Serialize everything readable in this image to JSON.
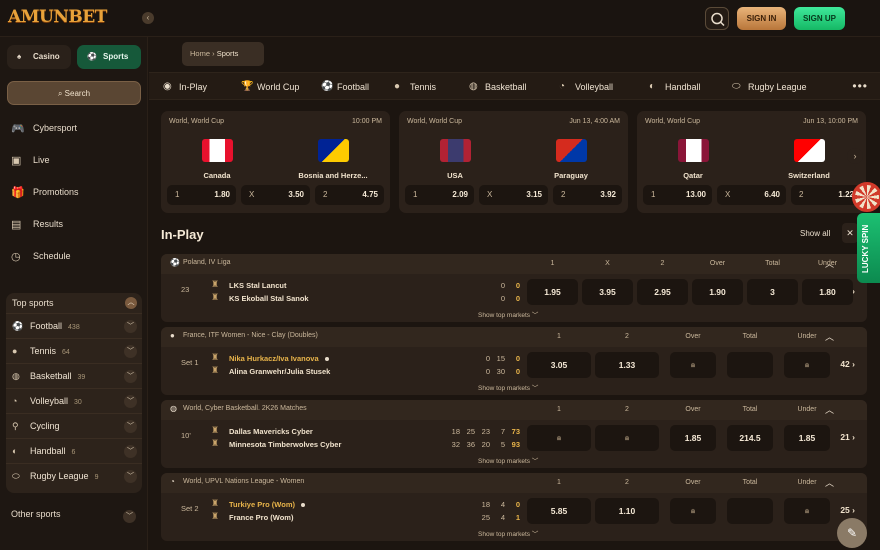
{
  "brand": {
    "logo_text": "AMUNBET"
  },
  "header": {
    "signin_label": "SIGN IN",
    "signup_label": "SIGN UP"
  },
  "sidebar": {
    "casino_label": "Casino",
    "sports_label": "Sports",
    "search_label": "Search",
    "nav": [
      {
        "label": "Cybersport",
        "icon": "gamepad-icon"
      },
      {
        "label": "Live",
        "icon": "live-tv-icon"
      },
      {
        "label": "Promotions",
        "icon": "gift-icon"
      },
      {
        "label": "Results",
        "icon": "clipboard-icon"
      },
      {
        "label": "Schedule",
        "icon": "clock-icon"
      }
    ],
    "top_sports_label": "Top sports",
    "top_sports": [
      {
        "label": "Football",
        "count": "438",
        "icon": "soccer-ball-icon"
      },
      {
        "label": "Tennis",
        "count": "64",
        "icon": "tennis-ball-icon"
      },
      {
        "label": "Basketball",
        "count": "39",
        "icon": "basketball-icon"
      },
      {
        "label": "Volleyball",
        "count": "30",
        "icon": "volleyball-icon"
      },
      {
        "label": "Cycling",
        "count": "",
        "icon": "bicycle-icon"
      },
      {
        "label": "Handball",
        "count": "6",
        "icon": "handball-icon"
      },
      {
        "label": "Rugby League",
        "count": "9",
        "icon": "rugby-ball-icon"
      }
    ],
    "other_sports_label": "Other sports"
  },
  "breadcrumb": {
    "home": "Home",
    "current": "Sports"
  },
  "tabs": [
    {
      "label": "In-Play",
      "icon": "live-icon"
    },
    {
      "label": "World Cup",
      "icon": "trophy-icon"
    },
    {
      "label": "Football",
      "icon": "soccer-ball-icon"
    },
    {
      "label": "Tennis",
      "icon": "tennis-ball-icon"
    },
    {
      "label": "Basketball",
      "icon": "basketball-icon"
    },
    {
      "label": "Volleyball",
      "icon": "volleyball-icon"
    },
    {
      "label": "Handball",
      "icon": "handball-icon"
    },
    {
      "label": "Rugby League",
      "icon": "rugby-ball-icon"
    }
  ],
  "featured": [
    {
      "league": "World, World Cup",
      "time": "10:00 PM",
      "home": "Canada",
      "away": "Bosnia and Herze...",
      "odds": [
        {
          "l": "1",
          "v": "1.80"
        },
        {
          "l": "X",
          "v": "3.50"
        },
        {
          "l": "2",
          "v": "4.75"
        }
      ],
      "home_colors": [
        "#e8112d",
        "#ffffff"
      ],
      "away_colors": [
        "#002395",
        "#fecb00"
      ]
    },
    {
      "league": "World, World Cup",
      "time": "Jun 13, 4:00 AM",
      "home": "USA",
      "away": "Paraguay",
      "odds": [
        {
          "l": "1",
          "v": "2.09"
        },
        {
          "l": "X",
          "v": "3.15"
        },
        {
          "l": "2",
          "v": "3.92"
        }
      ],
      "home_colors": [
        "#b22234",
        "#3c3b6e"
      ],
      "away_colors": [
        "#d52b1e",
        "#0038a8"
      ]
    },
    {
      "league": "World, World Cup",
      "time": "Jun 13, 10:00 PM",
      "home": "Qatar",
      "away": "Switzerland",
      "odds": [
        {
          "l": "1",
          "v": "13.00"
        },
        {
          "l": "X",
          "v": "6.40"
        },
        {
          "l": "2",
          "v": "1.22"
        }
      ],
      "home_colors": [
        "#8a1538",
        "#ffffff"
      ],
      "away_colors": [
        "#ff0000",
        "#ffffff"
      ]
    }
  ],
  "inplay": {
    "title": "In-Play",
    "show_all": "Show all",
    "show_top_markets": "Show top markets",
    "events": [
      {
        "league": "Poland, IV Liga",
        "period": "23",
        "home": "LKS Stal Lancut",
        "away": "KS Ekoball Stal Sanok",
        "serving": "",
        "scores": [
          [
            "0",
            "0"
          ],
          [
            "0",
            "0"
          ]
        ],
        "score_cols": 2,
        "cols": [
          "1",
          "X",
          "2",
          "Over",
          "Total",
          "Under"
        ],
        "odds": [
          "1.95",
          "3.95",
          "2.95",
          "1.90",
          "3",
          "1.80"
        ],
        "markets": "42"
      },
      {
        "league": "France, ITF Women - Nice - Clay (Doubles)",
        "period": "Set 1",
        "home": "Nika Hurkacz/Iva Ivanova",
        "away": "Alina Granwehr/Julia Stusek",
        "serving": "home",
        "scores": [
          [
            "0",
            "15",
            "0"
          ],
          [
            "0",
            "30",
            "0"
          ]
        ],
        "cols": [
          "1",
          "2",
          "Over",
          "Total",
          "Under"
        ],
        "odds": [
          "3.05",
          "1.33",
          "lock",
          "",
          "lock"
        ],
        "markets": "42"
      },
      {
        "league": "World, Cyber Basketball. 2K26 Matches",
        "period": "10'",
        "home": "Dallas Mavericks Cyber",
        "away": "Minnesota Timberwolves Cyber",
        "serving": "",
        "scores": [
          [
            "18",
            "25",
            "23",
            "7",
            "73"
          ],
          [
            "32",
            "36",
            "20",
            "5",
            "93"
          ]
        ],
        "cols": [
          "1",
          "2",
          "Over",
          "Total",
          "Under"
        ],
        "odds": [
          "lock",
          "lock",
          "1.85",
          "214.5",
          "1.85"
        ],
        "markets": "21"
      },
      {
        "league": "World, UPVL Nations League - Women",
        "period": "Set 2",
        "home": "Turkiye Pro (Wom)",
        "away": "France Pro (Wom)",
        "serving": "home",
        "scores": [
          [
            "18",
            "4",
            "0"
          ],
          [
            "25",
            "4",
            "1"
          ]
        ],
        "cols": [
          "1",
          "2",
          "Over",
          "Total",
          "Under"
        ],
        "odds": [
          "5.85",
          "1.10",
          "lock",
          "",
          "lock"
        ],
        "markets": "25"
      }
    ]
  },
  "widgets": {
    "lucky_spin": "LUCKY SPIN"
  },
  "colors": {
    "accent_gold": "#e8b44a",
    "sports_green": "#16593a",
    "signup_green": "#1cc072"
  }
}
